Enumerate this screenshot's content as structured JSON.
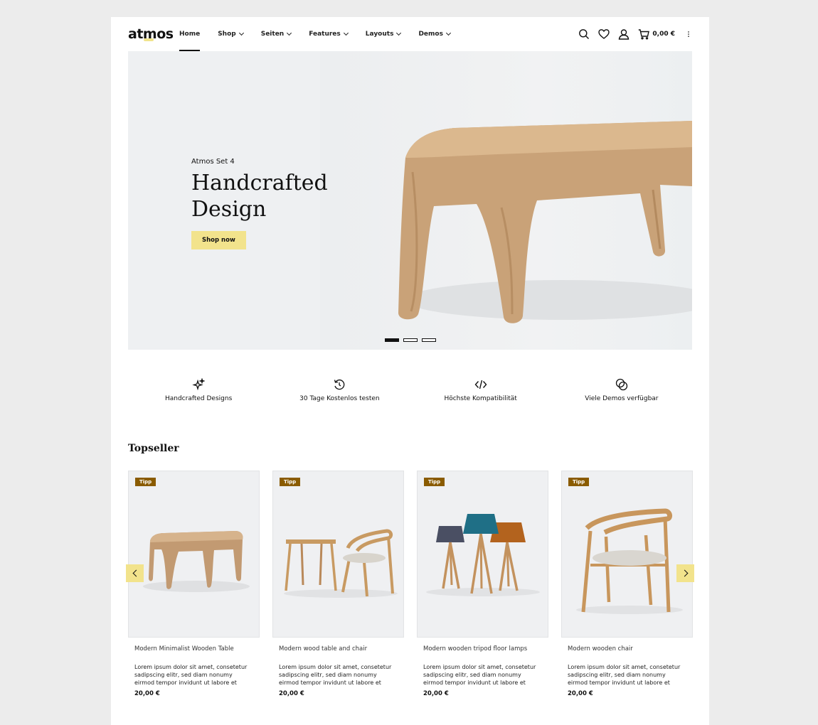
{
  "header": {
    "logo": "atmos",
    "nav": [
      {
        "label": "Home",
        "active": true,
        "dropdown": false
      },
      {
        "label": "Shop",
        "dropdown": true
      },
      {
        "label": "Seiten",
        "dropdown": true
      },
      {
        "label": "Features",
        "dropdown": true
      },
      {
        "label": "Layouts",
        "dropdown": true
      },
      {
        "label": "Demos",
        "dropdown": true
      }
    ],
    "icons": [
      "search-icon",
      "heart-icon",
      "user-icon",
      "cart-icon",
      "more-vertical-icon"
    ],
    "cart_total": "0,00 €"
  },
  "hero": {
    "subtitle": "Atmos Set 4",
    "title": "Handcrafted Design",
    "button": "Shop now",
    "slides": 3,
    "active_slide": 1
  },
  "features": [
    {
      "icon": "sparkles-icon",
      "label": "Handcrafted Designs"
    },
    {
      "icon": "history-icon",
      "label": "30 Tage Kostenlos testen"
    },
    {
      "icon": "code-icon",
      "label": "Höchste Kompatibilität"
    },
    {
      "icon": "circles-icon",
      "label": "Viele Demos verfügbar"
    }
  ],
  "topseller": {
    "title": "Topseller",
    "products": [
      {
        "badge": "Tipp",
        "title": "Modern Minimalist Wooden Table",
        "desc": "Lorem ipsum dolor sit amet, consetetur sadipscing elitr, sed diam nonumy eirmod tempor invidunt ut labore et dolore magn...",
        "price": "20,00 €"
      },
      {
        "badge": "Tipp",
        "title": "Modern wood table and chair",
        "desc": "Lorem ipsum dolor sit amet, consetetur sadipscing elitr, sed diam nonumy eirmod tempor invidunt ut labore et dolore magn...",
        "price": "20,00 €"
      },
      {
        "badge": "Tipp",
        "title": "Modern wooden tripod floor lamps",
        "desc": "Lorem ipsum dolor sit amet, consetetur sadipscing elitr, sed diam nonumy eirmod tempor invidunt ut labore et dolore magn...",
        "price": "20,00 €"
      },
      {
        "badge": "Tipp",
        "title": "Modern wooden chair",
        "desc": "Lorem ipsum dolor sit amet, consetetur sadipscing elitr, sed diam nonumy eirmod tempor invidunt ut labore et dolore magn...",
        "price": "20,00 €"
      }
    ]
  },
  "colors": {
    "accent": "#f2e38c",
    "badge": "#8a5b00",
    "wood": "#c49a6c"
  }
}
